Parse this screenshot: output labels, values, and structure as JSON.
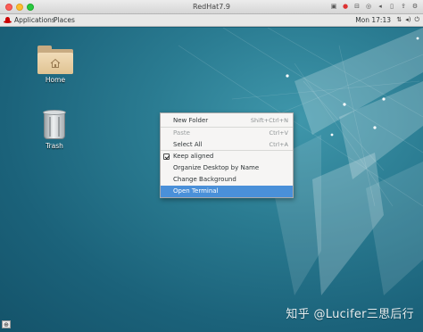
{
  "host_window": {
    "title": "RedHat7.9",
    "tools": [
      "record-icon",
      "stop-icon",
      "usb-icon",
      "cd-icon",
      "speaker-icon",
      "mic-icon",
      "share-icon",
      "settings-icon"
    ]
  },
  "top_bar": {
    "applications_label": "Applications",
    "places_label": "Places",
    "clock": "Mon 17:13",
    "tray": [
      "network-icon",
      "volume-icon",
      "power-icon"
    ]
  },
  "desktop": {
    "icons": [
      {
        "label": "Home",
        "icon": "home-folder-icon"
      },
      {
        "label": "Trash",
        "icon": "trash-icon"
      }
    ]
  },
  "context_menu": {
    "items": [
      {
        "label": "New Folder",
        "accel": "Shift+Ctrl+N"
      },
      {
        "label": "Paste",
        "accel": "Ctrl+V"
      },
      {
        "label": "Select All",
        "accel": "Ctrl+A"
      },
      {
        "label": "Keep aligned",
        "checked": true
      },
      {
        "label": "Organize Desktop by Name"
      },
      {
        "label": "Change Background"
      },
      {
        "label": "Open Terminal"
      }
    ]
  },
  "watermark": "知乎 @Lucifer三思后行",
  "colors": {
    "menu_highlight": "#4a90d9",
    "desktop_bg": "#1b6178"
  }
}
